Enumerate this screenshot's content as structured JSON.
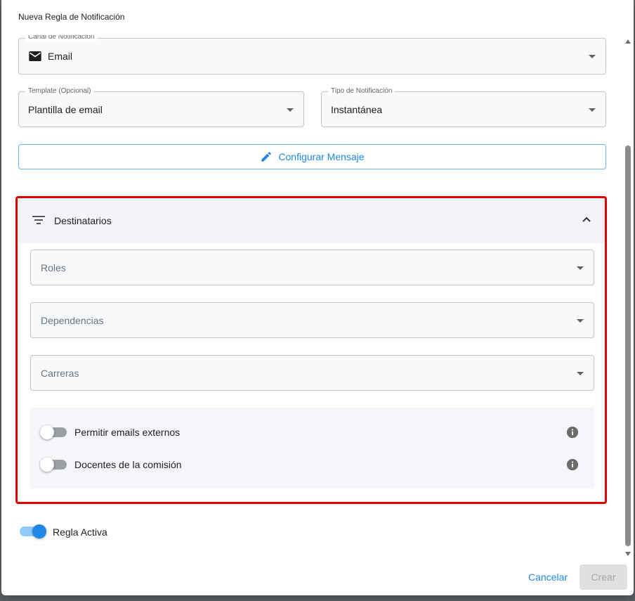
{
  "dialog": {
    "title": "Nueva Regla de Notificación"
  },
  "form": {
    "channel": {
      "label": "Canal de Notificación",
      "value": "Email",
      "icon": "mail-icon"
    },
    "template": {
      "label": "Template (Opcional)",
      "value": "Plantilla de email"
    },
    "type": {
      "label": "Tipo de Notificación",
      "value": "Instantánea"
    },
    "configure_button": {
      "label": "Configurar Mensaje",
      "icon": "pencil-icon"
    }
  },
  "recipients": {
    "title": "Destinatarios",
    "expanded": true,
    "roles_placeholder": "Roles",
    "dependencies_placeholder": "Dependencias",
    "careers_placeholder": "Carreras",
    "toggles": [
      {
        "label": "Permitir emails externos",
        "checked": false
      },
      {
        "label": "Docentes de la comisión",
        "checked": false
      }
    ]
  },
  "active_rule": {
    "label": "Regla Activa",
    "checked": true
  },
  "footer": {
    "cancel_label": "Cancelar",
    "create_label": "Crear"
  },
  "colors": {
    "accent": "#1e88e5",
    "highlight_border": "#e00000"
  }
}
